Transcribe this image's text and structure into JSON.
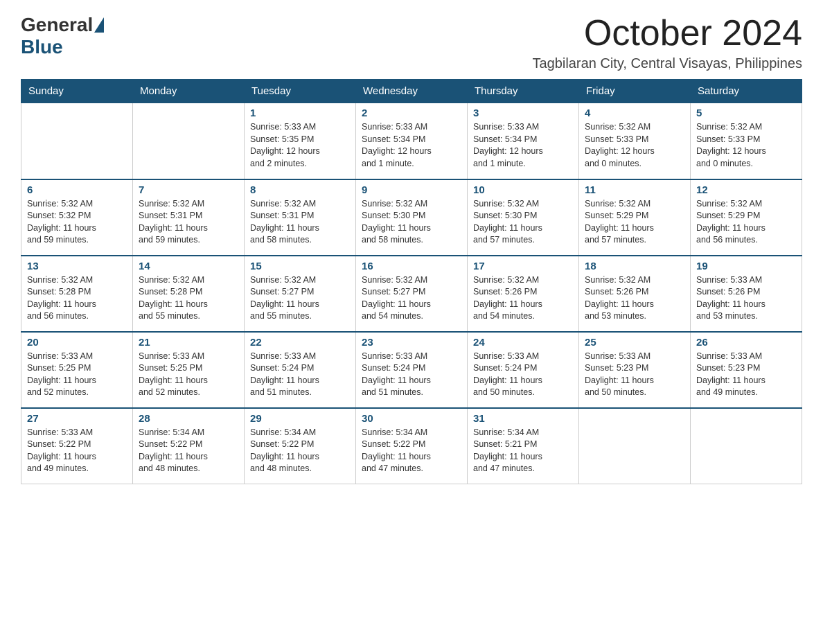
{
  "logo": {
    "general": "General",
    "blue": "Blue"
  },
  "title": "October 2024",
  "subtitle": "Tagbilaran City, Central Visayas, Philippines",
  "days_of_week": [
    "Sunday",
    "Monday",
    "Tuesday",
    "Wednesday",
    "Thursday",
    "Friday",
    "Saturday"
  ],
  "weeks": [
    [
      {
        "day": "",
        "info": ""
      },
      {
        "day": "",
        "info": ""
      },
      {
        "day": "1",
        "info": "Sunrise: 5:33 AM\nSunset: 5:35 PM\nDaylight: 12 hours\nand 2 minutes."
      },
      {
        "day": "2",
        "info": "Sunrise: 5:33 AM\nSunset: 5:34 PM\nDaylight: 12 hours\nand 1 minute."
      },
      {
        "day": "3",
        "info": "Sunrise: 5:33 AM\nSunset: 5:34 PM\nDaylight: 12 hours\nand 1 minute."
      },
      {
        "day": "4",
        "info": "Sunrise: 5:32 AM\nSunset: 5:33 PM\nDaylight: 12 hours\nand 0 minutes."
      },
      {
        "day": "5",
        "info": "Sunrise: 5:32 AM\nSunset: 5:33 PM\nDaylight: 12 hours\nand 0 minutes."
      }
    ],
    [
      {
        "day": "6",
        "info": "Sunrise: 5:32 AM\nSunset: 5:32 PM\nDaylight: 11 hours\nand 59 minutes."
      },
      {
        "day": "7",
        "info": "Sunrise: 5:32 AM\nSunset: 5:31 PM\nDaylight: 11 hours\nand 59 minutes."
      },
      {
        "day": "8",
        "info": "Sunrise: 5:32 AM\nSunset: 5:31 PM\nDaylight: 11 hours\nand 58 minutes."
      },
      {
        "day": "9",
        "info": "Sunrise: 5:32 AM\nSunset: 5:30 PM\nDaylight: 11 hours\nand 58 minutes."
      },
      {
        "day": "10",
        "info": "Sunrise: 5:32 AM\nSunset: 5:30 PM\nDaylight: 11 hours\nand 57 minutes."
      },
      {
        "day": "11",
        "info": "Sunrise: 5:32 AM\nSunset: 5:29 PM\nDaylight: 11 hours\nand 57 minutes."
      },
      {
        "day": "12",
        "info": "Sunrise: 5:32 AM\nSunset: 5:29 PM\nDaylight: 11 hours\nand 56 minutes."
      }
    ],
    [
      {
        "day": "13",
        "info": "Sunrise: 5:32 AM\nSunset: 5:28 PM\nDaylight: 11 hours\nand 56 minutes."
      },
      {
        "day": "14",
        "info": "Sunrise: 5:32 AM\nSunset: 5:28 PM\nDaylight: 11 hours\nand 55 minutes."
      },
      {
        "day": "15",
        "info": "Sunrise: 5:32 AM\nSunset: 5:27 PM\nDaylight: 11 hours\nand 55 minutes."
      },
      {
        "day": "16",
        "info": "Sunrise: 5:32 AM\nSunset: 5:27 PM\nDaylight: 11 hours\nand 54 minutes."
      },
      {
        "day": "17",
        "info": "Sunrise: 5:32 AM\nSunset: 5:26 PM\nDaylight: 11 hours\nand 54 minutes."
      },
      {
        "day": "18",
        "info": "Sunrise: 5:32 AM\nSunset: 5:26 PM\nDaylight: 11 hours\nand 53 minutes."
      },
      {
        "day": "19",
        "info": "Sunrise: 5:33 AM\nSunset: 5:26 PM\nDaylight: 11 hours\nand 53 minutes."
      }
    ],
    [
      {
        "day": "20",
        "info": "Sunrise: 5:33 AM\nSunset: 5:25 PM\nDaylight: 11 hours\nand 52 minutes."
      },
      {
        "day": "21",
        "info": "Sunrise: 5:33 AM\nSunset: 5:25 PM\nDaylight: 11 hours\nand 52 minutes."
      },
      {
        "day": "22",
        "info": "Sunrise: 5:33 AM\nSunset: 5:24 PM\nDaylight: 11 hours\nand 51 minutes."
      },
      {
        "day": "23",
        "info": "Sunrise: 5:33 AM\nSunset: 5:24 PM\nDaylight: 11 hours\nand 51 minutes."
      },
      {
        "day": "24",
        "info": "Sunrise: 5:33 AM\nSunset: 5:24 PM\nDaylight: 11 hours\nand 50 minutes."
      },
      {
        "day": "25",
        "info": "Sunrise: 5:33 AM\nSunset: 5:23 PM\nDaylight: 11 hours\nand 50 minutes."
      },
      {
        "day": "26",
        "info": "Sunrise: 5:33 AM\nSunset: 5:23 PM\nDaylight: 11 hours\nand 49 minutes."
      }
    ],
    [
      {
        "day": "27",
        "info": "Sunrise: 5:33 AM\nSunset: 5:22 PM\nDaylight: 11 hours\nand 49 minutes."
      },
      {
        "day": "28",
        "info": "Sunrise: 5:34 AM\nSunset: 5:22 PM\nDaylight: 11 hours\nand 48 minutes."
      },
      {
        "day": "29",
        "info": "Sunrise: 5:34 AM\nSunset: 5:22 PM\nDaylight: 11 hours\nand 48 minutes."
      },
      {
        "day": "30",
        "info": "Sunrise: 5:34 AM\nSunset: 5:22 PM\nDaylight: 11 hours\nand 47 minutes."
      },
      {
        "day": "31",
        "info": "Sunrise: 5:34 AM\nSunset: 5:21 PM\nDaylight: 11 hours\nand 47 minutes."
      },
      {
        "day": "",
        "info": ""
      },
      {
        "day": "",
        "info": ""
      }
    ]
  ]
}
